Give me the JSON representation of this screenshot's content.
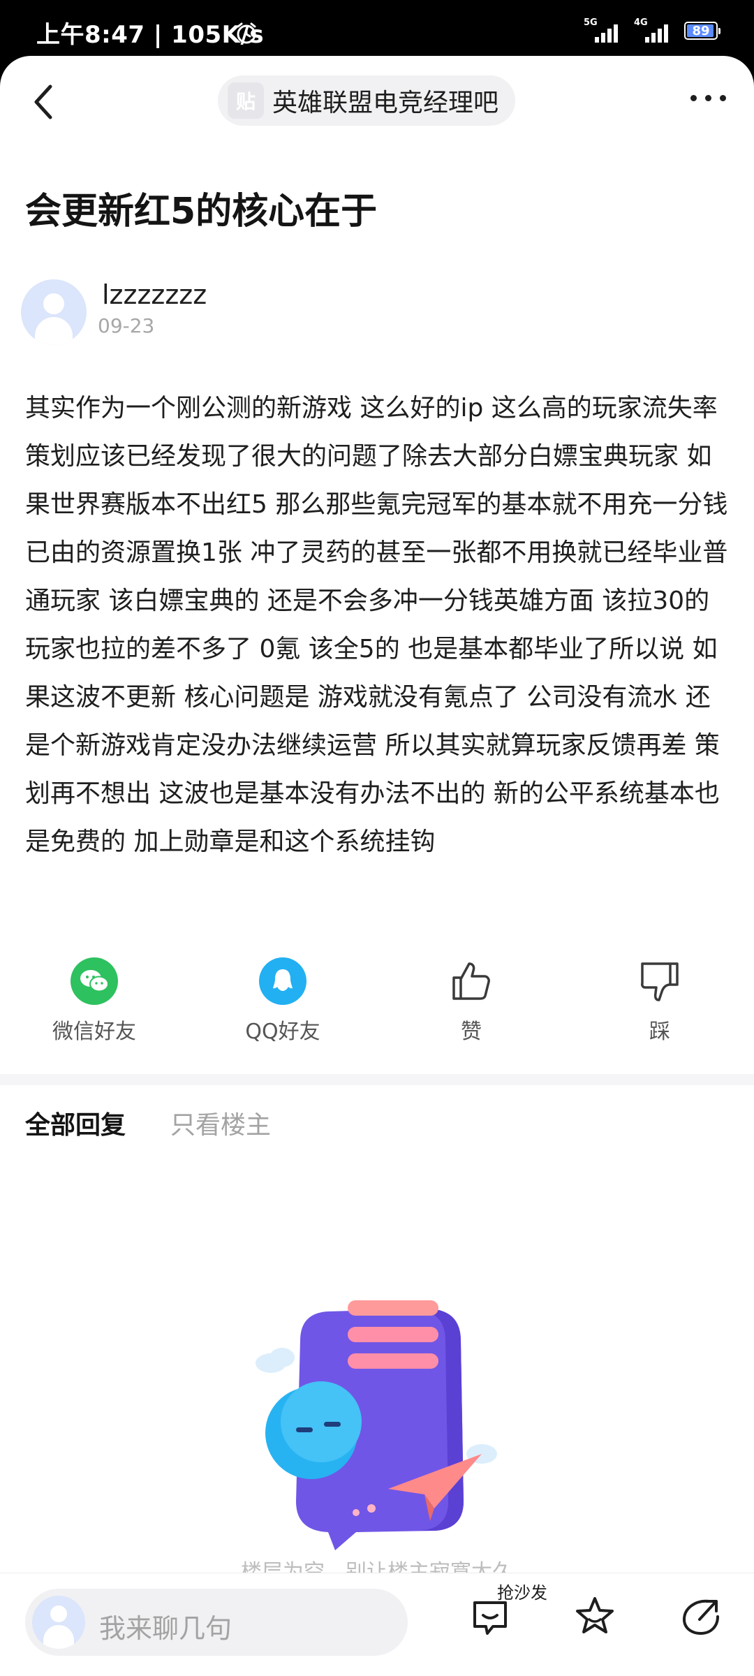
{
  "status_bar": {
    "time": "上午8:47 | 105K/s",
    "sim1_label": "5G",
    "sim2_label": "4G",
    "battery": "89",
    "icons": [
      "alarm-icon",
      "signal-icon",
      "battery-icon"
    ]
  },
  "nav": {
    "forum_name": "英雄联盟电竞经理吧",
    "forum_logo_glyph": "贴"
  },
  "post": {
    "title": "会更新红5的核心在于",
    "author": "lzzzzzzz",
    "date": "09-23",
    "body": "其实作为一个刚公测的新游戏 这么好的ip 这么高的玩家流失率 策划应该已经发现了很大的问题了除去大部分白嫖宝典玩家 如果世界赛版本不出红5 那么那些氪完冠军的基本就不用充一分钱 已由的资源置换1张 冲了灵药的甚至一张都不用换就已经毕业普通玩家 该白嫖宝典的 还是不会多冲一分钱英雄方面 该拉30的玩家也拉的差不多了 0氪 该全5的 也是基本都毕业了所以说 如果这波不更新 核心问题是 游戏就没有氪点了 公司没有流水 还是个新游戏肯定没办法继续运营 所以其实就算玩家反馈再差 策划再不想出 这波也是基本没有办法不出的 新的公平系统基本也是免费的 加上勋章是和这个系统挂钩"
  },
  "actions": {
    "wechat": "微信好友",
    "qq": "QQ好友",
    "like": "赞",
    "dislike": "踩"
  },
  "tabs": {
    "all": "全部回复",
    "op_only": "只看楼主"
  },
  "empty": {
    "text": "楼层为空，别让楼主寂寞太久"
  },
  "bottom": {
    "placeholder": "我来聊几句",
    "sofa": "抢沙发"
  },
  "colors": {
    "accent_wechat": "#2ec15f",
    "accent_qq": "#22b0f2",
    "text_primary": "#1e1e1e",
    "text_secondary": "#a3a3a3"
  }
}
